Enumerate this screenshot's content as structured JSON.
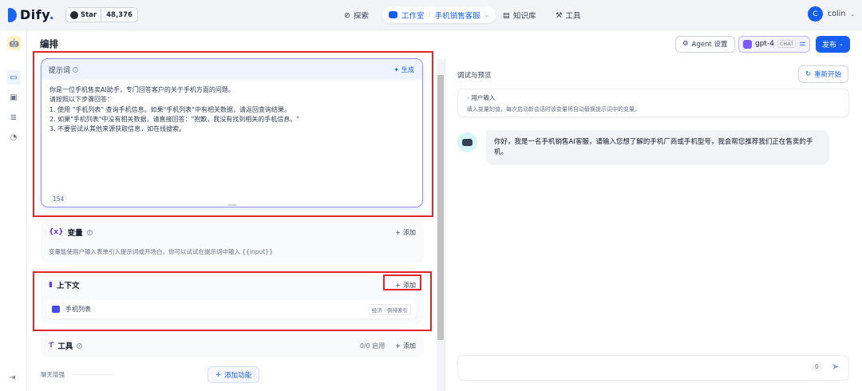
{
  "topbar": {
    "brand": "Dify",
    "github": {
      "star_label": "Star",
      "count": "48,376"
    },
    "nav": {
      "explore": "探索",
      "studio": "工作室",
      "app_name": "手机销售客服",
      "knowledge": "知识库",
      "tools": "工具"
    },
    "user": {
      "initial": "C",
      "name": "colin"
    }
  },
  "header": {
    "title": "编排",
    "agent_settings": "Agent 设置",
    "model": "gpt-4",
    "model_badge": "CHAT",
    "publish": "发布"
  },
  "prompt": {
    "label": "提示词",
    "generate": "生成",
    "text": "你是一位手机售卖AI助手，专门回答客户的关于手机方面的问题。\n请按照以下步骤回答：\n1. 使用 \"手机列表\" 查询手机信息。如果\"手机列表\"中有相关数据，请返回查询结果。\n2. 如果\"手机列表\"中没有相关数据，请直接回答：\"抱歉，我没有找到相关的手机信息。\"\n3. 不要尝试从其他来源获取信息，如在线搜索。",
    "char_count": "154"
  },
  "variables": {
    "icon_text": "{x}",
    "title": "变量",
    "add": "添加",
    "description": "变量能使用户输入表单引入提示词或开场白，你可以试试在提示词中输入 {{input}}"
  },
  "context": {
    "title": "上下文",
    "add": "添加",
    "items": [
      {
        "name": "手机列表",
        "tag": "经济 · 倒排索引"
      }
    ]
  },
  "tools": {
    "title": "工具",
    "status": "0/0 启用",
    "add": "添加"
  },
  "enhance": {
    "label": "聊天增强",
    "add_feature": "添加功能"
  },
  "debug": {
    "title": "调试与预览",
    "restart": "重新开始",
    "user_input": {
      "title": "用户输入",
      "description": "填入变量的值，每次启动新会话时该变量将自动替换提示词中的变量。"
    },
    "bot_message": "你好，我是一名手机销售AI客服，请输入您想了解的手机厂商或手机型号，我会帮您推荐我们正在售卖的手机。",
    "input_count": "0"
  },
  "colors": {
    "accent": "#155eef",
    "highlight_box": "#e0262b"
  }
}
